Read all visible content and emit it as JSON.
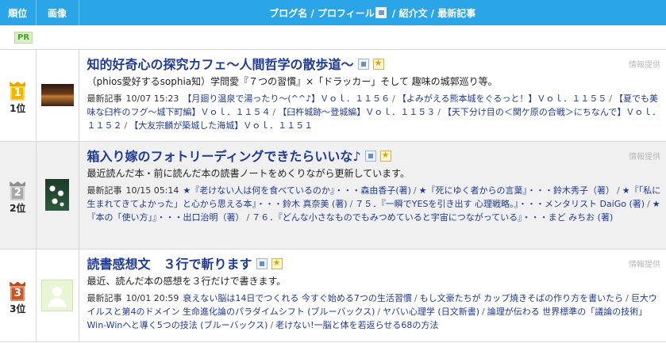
{
  "header": {
    "col_rank": "順位",
    "col_image": "画像",
    "col_main_a": "ブログ名 / プロフィール",
    "col_main_b": " / 紹介文 / 最新記事"
  },
  "pr_label": "PR",
  "provided_label": "情報提供",
  "recent_label": "最新記事",
  "entries": [
    {
      "rank": "1",
      "rank_text": "1位",
      "title": "知的好奇心の探究カフェ～人間哲学の散歩道～",
      "description": "（phios愛好するsophia知）学問愛『７つの習慣』×「ドラッカー」そして 趣味の城郭巡り等。",
      "timestamp": "10/07 15:23",
      "articles": [
        "【月廻り温泉で湯ったり～(^^♪】Ｖｏｌ．１１５６",
        "【よみがえる熊本城をぐるっと！】Ｖｏｌ．１１５５",
        "【夏でも美味な臼杵のフグ～城下町編】Ｖｏｌ．１１５４",
        "【臼杵城跡～登城編】Ｖｏｌ．１１５３",
        "【天下分け目の＜関ケ原の合戦＞にちなんで】Ｖｏｌ．１１５２",
        "【大友宗麟が築城した海城】Ｖｏｌ．１１５１"
      ]
    },
    {
      "rank": "2",
      "rank_text": "2位",
      "title": "箱入り嫁のフォトリーディングできたらいいな♪",
      "description": "最近読んだ本・前に読んだ本の読書ノートをめくりながら更新しています。",
      "timestamp": "10/15 05:14",
      "articles": [
        "★『老けない人は何を食べているのか』・・・森由香子(著)",
        "★『死にゆく者からの言葉』・・・鈴木秀子（著）",
        "★『「私に生まれてきてよかった」と心から思える本』・・・鈴木 真奈美 (著)",
        "７５．『一瞬でYESを引き出す 心理戦略。』・・・メンタリスト DaiGo (著)",
        "★『本の「使い方」』・・・出口治明（著）",
        "７６．『どんな小さなものでもみつめていると宇宙につながっている』・・・まど みちお (著)"
      ]
    },
    {
      "rank": "3",
      "rank_text": "3位",
      "title": "読書感想文　３行で斬ります",
      "description": "最近、読んだ本の感想を３行だけで書きます。",
      "timestamp": "10/01 20:59",
      "articles": [
        "衰えない脳は14日でつくれる 今すぐ始める7つの生活習慣",
        "もし文豪たちが カップ焼きそばの作り方を書いたら",
        "巨大ウイルスと第4のドメイン 生命進化論のパラダイムシフト (ブルーバックス)",
        "ヤバい心理学 (日文新書)",
        "論理が伝わる 世界標準の「議論の技術」 Win-Winへと導く5つの技法 (ブルーバックス)",
        "老けない!一脳と体を若返らせる68の方法"
      ]
    }
  ]
}
